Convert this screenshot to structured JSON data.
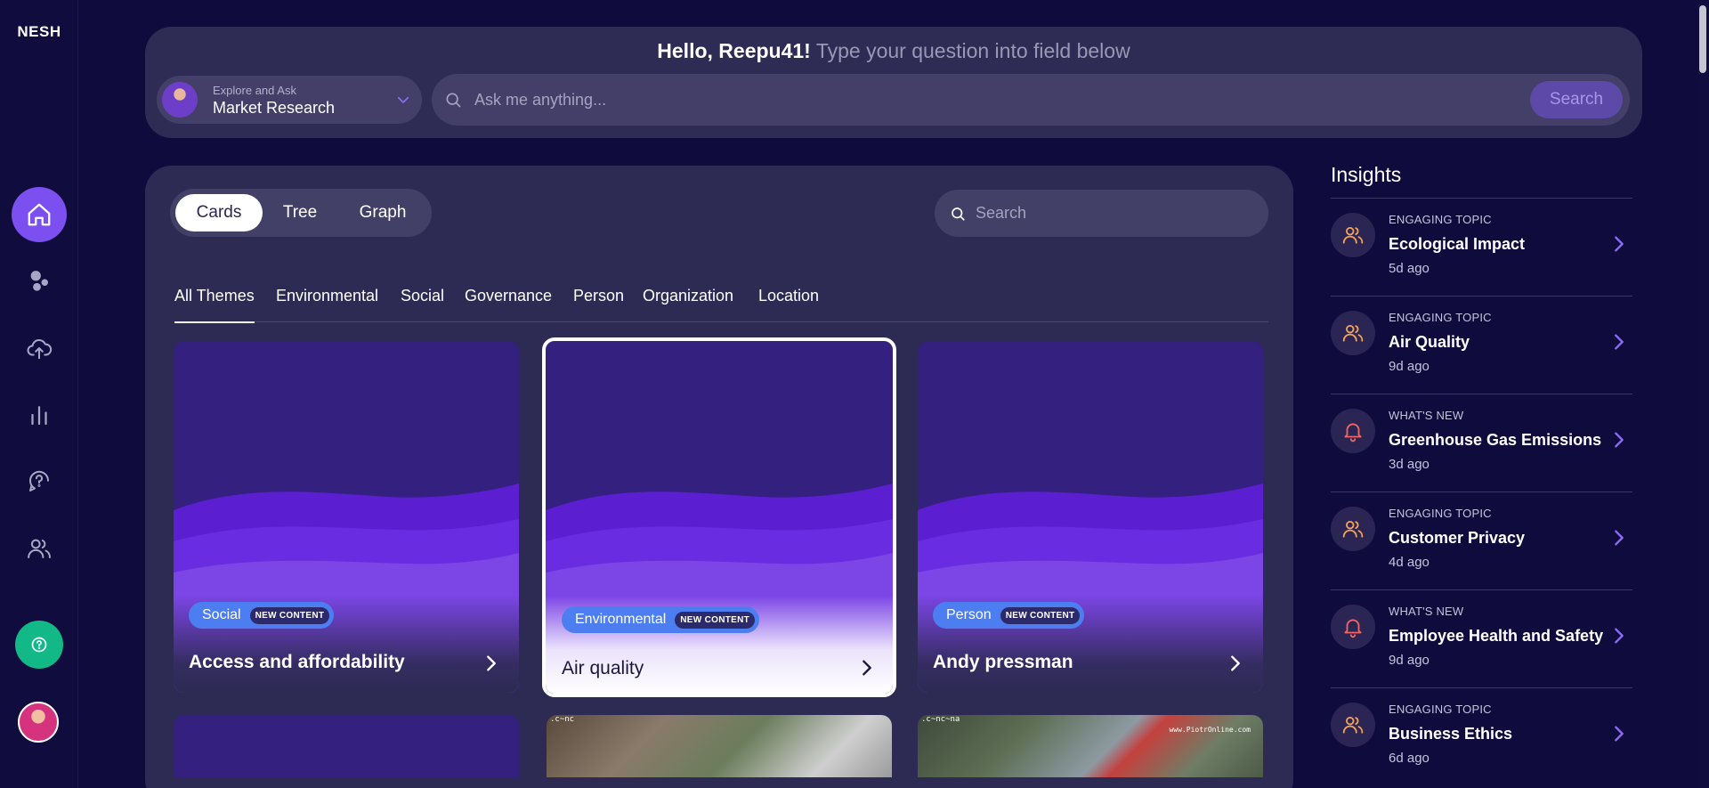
{
  "app": {
    "logo": "NESH"
  },
  "rail": {
    "items": [
      {
        "name": "home-icon",
        "active": true
      },
      {
        "name": "bubbles-icon",
        "active": false
      },
      {
        "name": "cloud-upload-icon",
        "active": false
      },
      {
        "name": "bar-chart-icon",
        "active": false
      },
      {
        "name": "chat-question-icon",
        "active": false
      },
      {
        "name": "users-icon",
        "active": false
      }
    ],
    "help_icon": "help-circle-icon"
  },
  "header": {
    "greeting": "Hello, Reepu41!",
    "subtitle": "Type your question into field below",
    "project_caption": "Explore and Ask",
    "project_name": "Market Research",
    "ask_placeholder": "Ask me anything...",
    "ask_button": "Search"
  },
  "main": {
    "views": [
      "Cards",
      "Tree",
      "Graph"
    ],
    "active_view": "Cards",
    "search_placeholder": "Search",
    "themes": [
      "All Themes",
      "Environmental",
      "Social",
      "Governance",
      "Person",
      "Organization",
      "Location"
    ],
    "active_theme": "All Themes",
    "new_badge": "NEW CONTENT",
    "cards": [
      {
        "tag": "Social",
        "title": "Access and affordability",
        "selected": false
      },
      {
        "tag": "Environmental",
        "title": "Air quality",
        "selected": true
      },
      {
        "tag": "Person",
        "title": "Andy pressman",
        "selected": false
      }
    ],
    "photo_labels": {
      "first": ".c~nc",
      "second": ".c~nc~na",
      "watermark": "www.PiotrOnline.com"
    }
  },
  "insights": {
    "title": "Insights",
    "items": [
      {
        "kind": "ENGAGING TOPIC",
        "title": "Ecological Impact",
        "time": "5d ago",
        "icon": "users-icon"
      },
      {
        "kind": "ENGAGING TOPIC",
        "title": "Air Quality",
        "time": "9d ago",
        "icon": "users-icon"
      },
      {
        "kind": "WHAT'S NEW",
        "title": "Greenhouse Gas Emissions",
        "time": "3d ago",
        "icon": "bell-icon"
      },
      {
        "kind": "ENGAGING TOPIC",
        "title": "Customer Privacy",
        "time": "4d ago",
        "icon": "users-icon"
      },
      {
        "kind": "WHAT'S NEW",
        "title": "Employee Health and Safety",
        "time": "9d ago",
        "icon": "bell-icon"
      },
      {
        "kind": "ENGAGING TOPIC",
        "title": "Business Ethics",
        "time": "6d ago",
        "icon": "users-icon"
      }
    ]
  },
  "colors": {
    "background": "#0f0b3d",
    "panel": "#2d2a53",
    "accent": "#7b4ff0",
    "tag": "#4c7ef2",
    "engaging_icon": "#f5a25b",
    "whatsnew_icon": "#f06565",
    "help": "#12b886"
  }
}
